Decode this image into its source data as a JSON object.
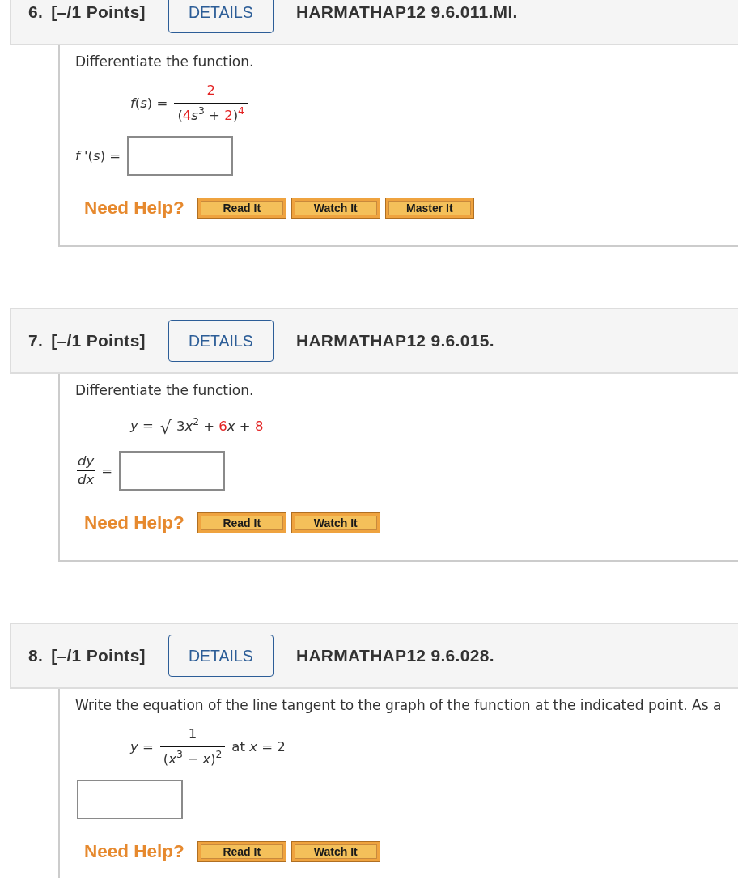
{
  "questions": [
    {
      "number": "6.",
      "points": "[–/1 Points]",
      "details": "DETAILS",
      "code": "HARMATHAP12 9.6.011.MI.",
      "prompt": "Differentiate the function.",
      "formula": [
        {
          "kind": "text",
          "tokens": [
            {
              "text": "*f*(*s*) =",
              "highlighted": false
            }
          ]
        },
        {
          "kind": "frac",
          "numerator": [
            {
              "text": "2",
              "highlighted": true
            }
          ],
          "denominator": [
            {
              "text": "(",
              "highlighted": false
            },
            {
              "text": "4",
              "highlighted": true
            },
            {
              "text": "*s*$^{3}$ + ",
              "highlighted": false
            },
            {
              "text": "2",
              "highlighted": true
            },
            {
              "text": ")",
              "highlighted": false
            },
            {
              "text": "$^{4}$",
              "highlighted": true
            }
          ]
        }
      ],
      "answer_label": [
        {
          "kind": "text",
          "tokens": [
            {
              "text": "*f* '(*s*) =",
              "highlighted": false
            }
          ]
        }
      ],
      "help": {
        "label": "Need Help?",
        "buttons": [
          "Read It",
          "Watch It",
          "Master It"
        ]
      }
    },
    {
      "number": "7.",
      "points": "[–/1 Points]",
      "details": "DETAILS",
      "code": "HARMATHAP12 9.6.015.",
      "prompt": "Differentiate the function.",
      "formula": [
        {
          "kind": "text",
          "tokens": [
            {
              "text": "*y* =",
              "highlighted": false
            }
          ]
        },
        {
          "kind": "sqrt",
          "symbol": "√",
          "radicand": [
            {
              "text": "3",
              "highlighted": false
            },
            {
              "text": "*x*$^{2}$ + ",
              "highlighted": false
            },
            {
              "text": "6",
              "highlighted": true
            },
            {
              "text": "*x* + ",
              "highlighted": false
            },
            {
              "text": "8",
              "highlighted": true
            }
          ]
        }
      ],
      "answer_label": [
        {
          "kind": "frac",
          "numerator": [
            {
              "text": "*dy*",
              "highlighted": false
            }
          ],
          "denominator": [
            {
              "text": "*dx*",
              "highlighted": false
            }
          ]
        },
        {
          "kind": "text",
          "tokens": [
            {
              "text": "=",
              "highlighted": false
            }
          ]
        }
      ],
      "help": {
        "label": "Need Help?",
        "buttons": [
          "Read It",
          "Watch It"
        ]
      }
    },
    {
      "number": "8.",
      "points": "[–/1 Points]",
      "details": "DETAILS",
      "code": "HARMATHAP12 9.6.028.",
      "prompt": "Write the equation of the line tangent to the graph of the function at the indicated point. As a",
      "formula": [
        {
          "kind": "text",
          "tokens": [
            {
              "text": "*y* =",
              "highlighted": false
            }
          ]
        },
        {
          "kind": "frac",
          "numerator": [
            {
              "text": "1",
              "highlighted": false
            }
          ],
          "denominator": [
            {
              "text": "(*x*$^{3}$ − *x*)$^{2}$",
              "highlighted": false
            }
          ]
        },
        {
          "kind": "text",
          "tokens": [
            {
              "text": "at *x* = 2",
              "highlighted": false
            }
          ]
        }
      ],
      "help": {
        "label": "Need Help?",
        "buttons": [
          "Read It",
          "Watch It"
        ]
      }
    }
  ]
}
